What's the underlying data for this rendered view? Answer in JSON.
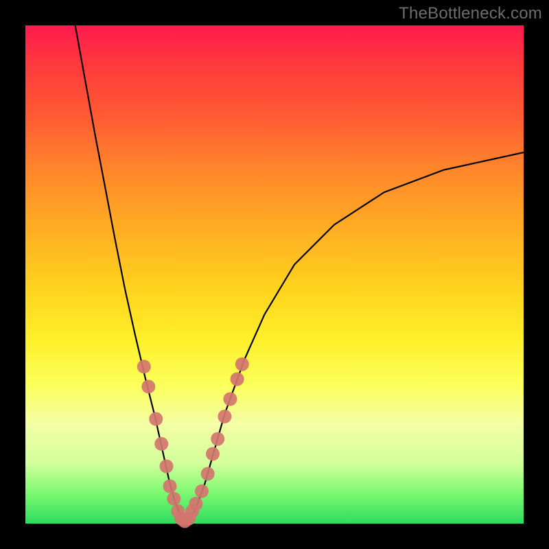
{
  "watermark": "TheBottleneck.com",
  "colors": {
    "frame": "#000000",
    "gradient_top": "#ff1a4d",
    "gradient_bottom": "#2fdc5f",
    "curve": "#000000",
    "marker_fill": "#d2756e",
    "marker_stroke": "#d2756e"
  },
  "chart_data": {
    "type": "line",
    "title": "",
    "xlabel": "",
    "ylabel": "",
    "xlim": [
      0,
      100
    ],
    "ylim": [
      0,
      100
    ],
    "grid": false,
    "legend": false,
    "series": [
      {
        "name": "curve",
        "x": [
          10,
          12,
          14,
          16,
          18,
          20,
          22,
          24,
          26,
          28,
          29,
          30,
          31,
          32,
          33,
          34,
          36,
          38,
          40,
          44,
          48,
          54,
          62,
          72,
          84,
          100
        ],
        "y": [
          100,
          89,
          78,
          67.5,
          57,
          47,
          38,
          29.5,
          21.5,
          12.5,
          8,
          4.5,
          2,
          0.5,
          1,
          2.5,
          8,
          15,
          22,
          33,
          42,
          52,
          60,
          66.5,
          71,
          74.5
        ]
      }
    ],
    "markers": [
      {
        "x": 23.8,
        "y": 31.5
      },
      {
        "x": 24.7,
        "y": 27.5
      },
      {
        "x": 26.2,
        "y": 21.0
      },
      {
        "x": 27.3,
        "y": 16.0
      },
      {
        "x": 28.3,
        "y": 11.5
      },
      {
        "x": 29.0,
        "y": 7.5
      },
      {
        "x": 29.8,
        "y": 5.0
      },
      {
        "x": 30.6,
        "y": 2.5
      },
      {
        "x": 31.3,
        "y": 1.0
      },
      {
        "x": 32.0,
        "y": 0.5
      },
      {
        "x": 32.8,
        "y": 1.0
      },
      {
        "x": 33.5,
        "y": 2.5
      },
      {
        "x": 34.2,
        "y": 4.0
      },
      {
        "x": 35.4,
        "y": 6.5
      },
      {
        "x": 36.6,
        "y": 10.0
      },
      {
        "x": 37.6,
        "y": 14.0
      },
      {
        "x": 38.6,
        "y": 17.0
      },
      {
        "x": 40.0,
        "y": 21.5
      },
      {
        "x": 41.1,
        "y": 25.0
      },
      {
        "x": 42.5,
        "y": 29.0
      },
      {
        "x": 43.5,
        "y": 32.0
      }
    ],
    "marker_radius": 10
  }
}
